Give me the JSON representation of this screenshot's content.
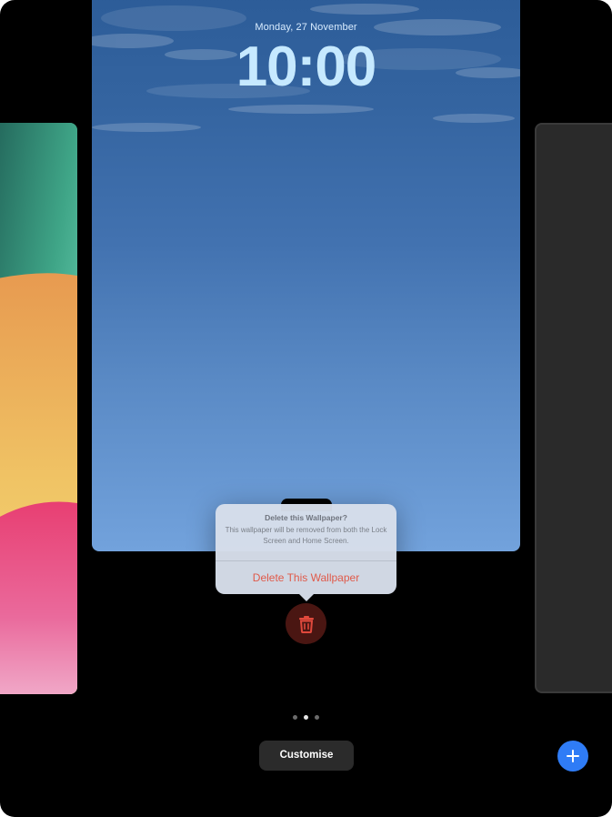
{
  "lock_screen": {
    "date": "Monday, 27 November",
    "time": "10:00"
  },
  "delete_popover": {
    "title": "Delete this Wallpaper?",
    "message": "This wallpaper will be removed from both the Lock Screen and Home Screen.",
    "action_label": "Delete This Wallpaper",
    "action_color": "#e05a4a"
  },
  "trash_button": {
    "icon": "trash-icon",
    "color": "#e0493c"
  },
  "page_indicator": {
    "count": 3,
    "current": 2
  },
  "bottom_bar": {
    "customise_label": "Customise",
    "add_icon": "plus-icon",
    "accent": "#2f7cf6"
  }
}
